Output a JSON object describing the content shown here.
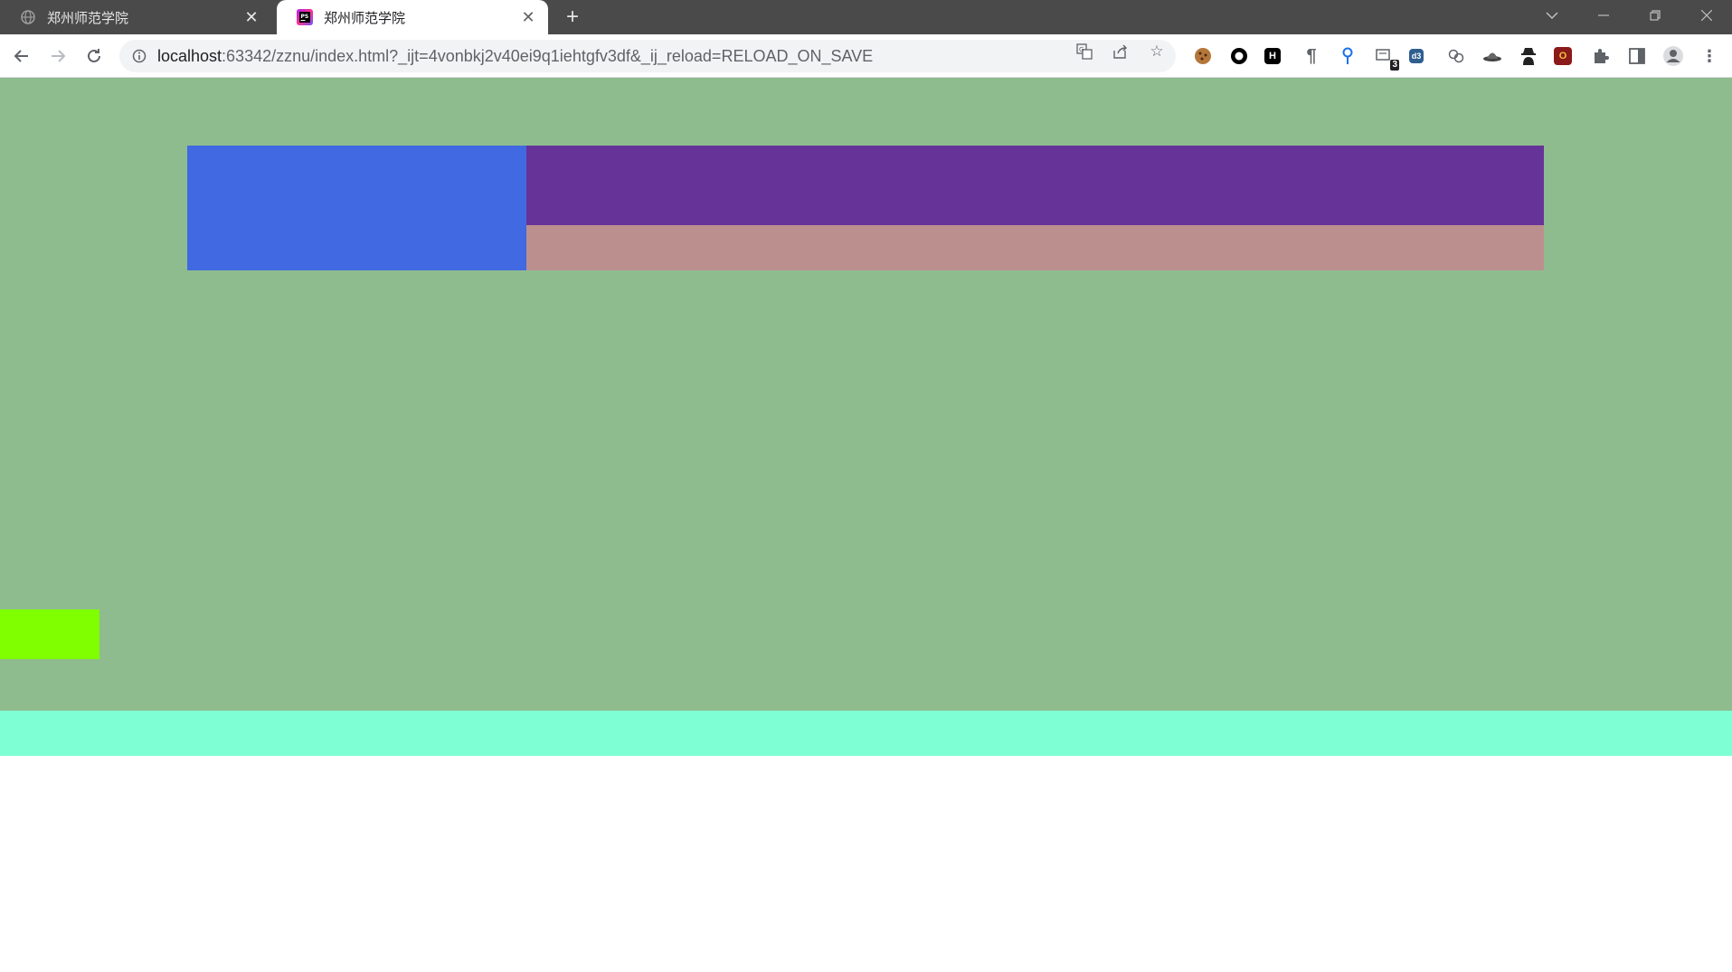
{
  "tabs": [
    {
      "title": "郑州师范学院",
      "active": false,
      "favicon": "globe-icon"
    },
    {
      "title": "郑州师范学院",
      "active": true,
      "favicon": "phpstorm-icon"
    }
  ],
  "toolbar": {
    "url_host": "localhost",
    "url_rest": ":63342/zznu/index.html?_ijt=4vonbkj2v40ei9q1iehtgfv3df&_ij_reload=RELOAD_ON_SAVE",
    "extension_badge": "3"
  },
  "page": {
    "background": "#8fbc8f",
    "blocks": {
      "blue": "#4169e1",
      "purple": "#663399",
      "rosy": "#bc8f8f",
      "lime": "#7fff00",
      "aquamarine": "#7fffd4"
    }
  }
}
